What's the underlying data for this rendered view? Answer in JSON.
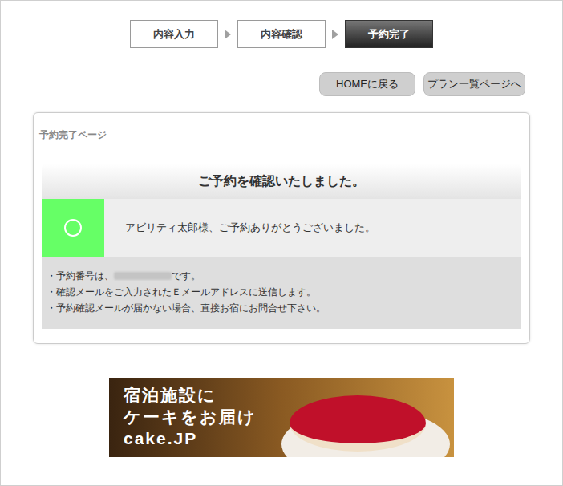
{
  "steps": [
    {
      "label": "内容入力",
      "selected": false
    },
    {
      "label": "内容確認",
      "selected": false
    },
    {
      "label": "予約完了",
      "selected": true
    }
  ],
  "buttons": [
    "HOMEに戻る",
    "プラン一覧ページへ"
  ],
  "card": {
    "title": "予約完了ページ",
    "heading": "ご予約を確認いたしました。",
    "message": "アビリティ太郎様、ご予約ありがとうございました。",
    "notes": [
      {
        "kind": "redacted",
        "text": "・予約番号は、",
        "after": "です。"
      },
      {
        "kind": "plain",
        "text": "・確認メールをご入力されたＥメールアドレスに送信します。"
      },
      {
        "kind": "plain",
        "text": "・予約確認メールが届かない場合、直接お宿にお問合せ下さい。"
      }
    ]
  },
  "banner": {
    "lines": [
      "宿泊施設に",
      "ケーキをお届け",
      "cake.JP"
    ]
  }
}
